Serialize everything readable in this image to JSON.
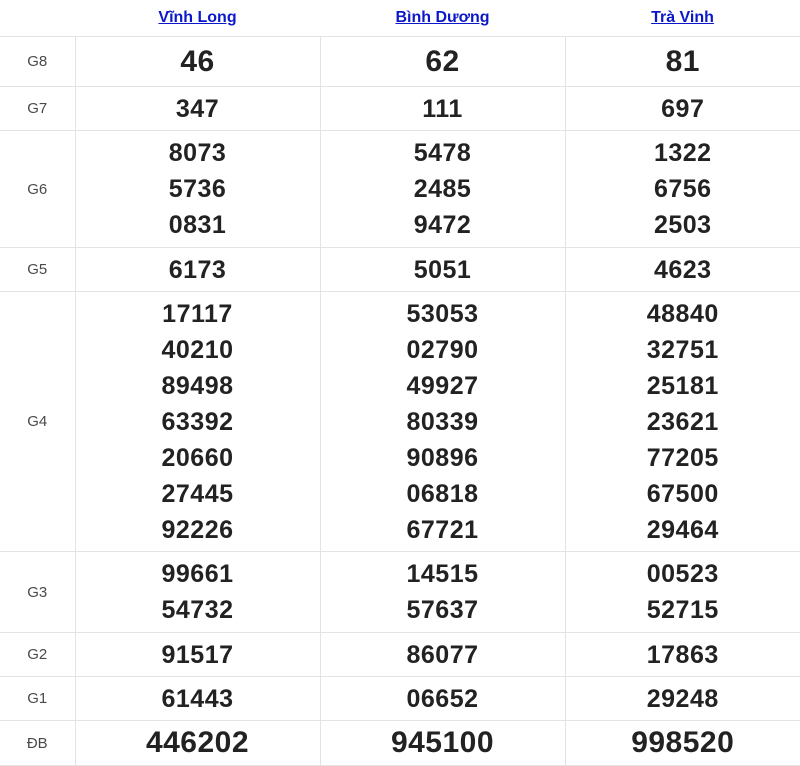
{
  "provinces": [
    "Vĩnh Long",
    "Bình Dương",
    "Trà Vinh"
  ],
  "colors": {
    "link": "#0b18c9",
    "highlight": "#e10000",
    "text": "#222222",
    "border": "#e3e3e3"
  },
  "prizes": [
    {
      "label": "G8",
      "values": [
        [
          "46"
        ],
        [
          "62"
        ],
        [
          "81"
        ]
      ]
    },
    {
      "label": "G7",
      "values": [
        [
          "347"
        ],
        [
          "111"
        ],
        [
          "697"
        ]
      ]
    },
    {
      "label": "G6",
      "values": [
        [
          "8073",
          "5736",
          "0831"
        ],
        [
          "5478",
          "2485",
          "9472"
        ],
        [
          "1322",
          "6756",
          "2503"
        ]
      ]
    },
    {
      "label": "G5",
      "values": [
        [
          "6173"
        ],
        [
          "5051"
        ],
        [
          "4623"
        ]
      ]
    },
    {
      "label": "G4",
      "values": [
        [
          "17117",
          "40210",
          "89498",
          "63392",
          "20660",
          "27445",
          "92226"
        ],
        [
          "53053",
          "02790",
          "49927",
          "80339",
          "90896",
          "06818",
          "67721"
        ],
        [
          "48840",
          "32751",
          "25181",
          "23621",
          "77205",
          "67500",
          "29464"
        ]
      ]
    },
    {
      "label": "G3",
      "values": [
        [
          "99661",
          "54732"
        ],
        [
          "14515",
          "57637"
        ],
        [
          "00523",
          "52715"
        ]
      ]
    },
    {
      "label": "G2",
      "values": [
        [
          "91517"
        ],
        [
          "86077"
        ],
        [
          "17863"
        ]
      ]
    },
    {
      "label": "G1",
      "values": [
        [
          "61443"
        ],
        [
          "06652"
        ],
        [
          "29248"
        ]
      ]
    },
    {
      "label": "ĐB",
      "values": [
        [
          "446202"
        ],
        [
          "945100"
        ],
        [
          "998520"
        ]
      ]
    }
  ]
}
